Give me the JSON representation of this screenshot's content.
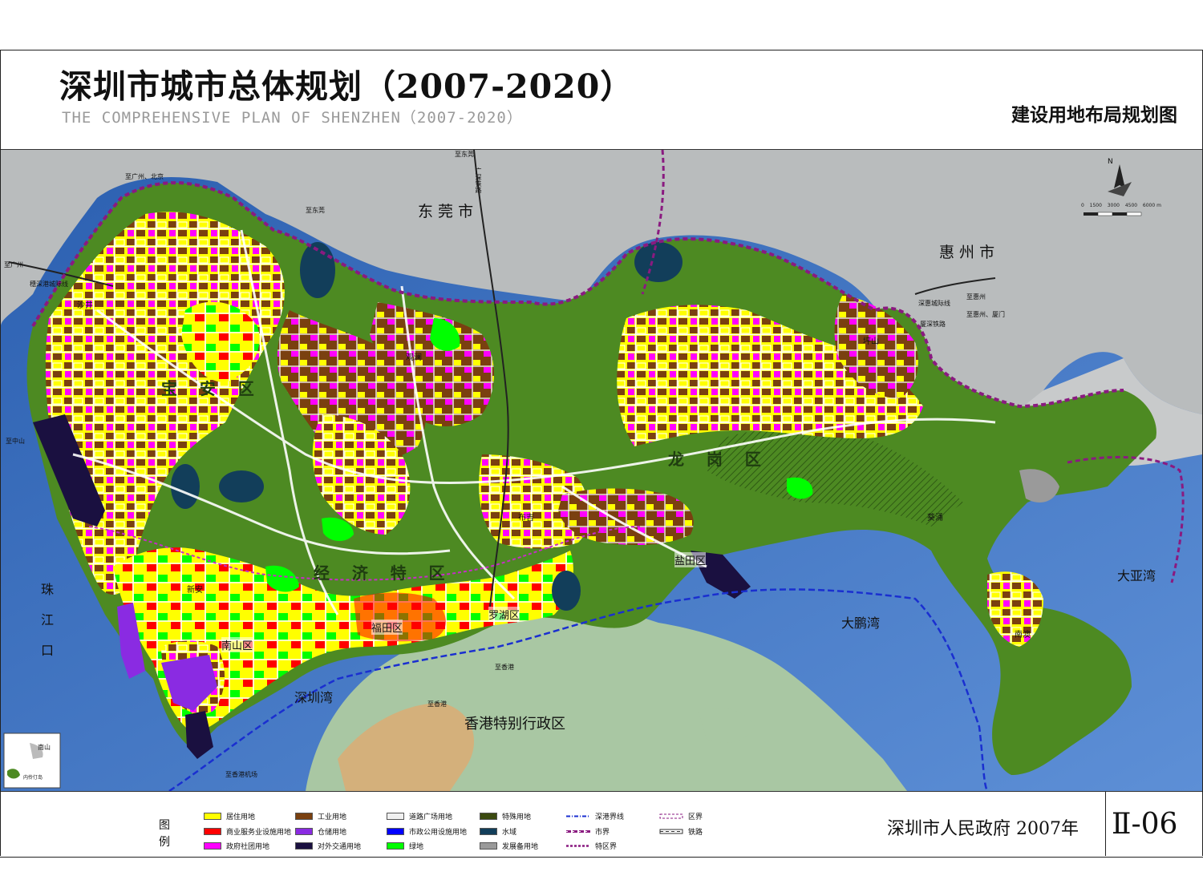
{
  "header": {
    "title": "深圳市城市总体规划（2007-2020）",
    "subtitle": "THE COMPREHENSIVE PLAN OF SHENZHEN（2007-2020）",
    "map_title": "建设用地布局规划图"
  },
  "map": {
    "regions": {
      "dongguan": "东 莞 市",
      "huizhou": "惠 州 市",
      "hongkong": "香港特别行政区",
      "baoan": "宝    安    区",
      "longgang": "龙    岗    区",
      "sez": "经    济    特    区",
      "nanshan": "南山区",
      "futian": "福田区",
      "luohu": "罗湖区",
      "yantian": "盐田区",
      "xin_an": "新安",
      "nanao": "南澳",
      "shajing": "沙井",
      "guanlan": "观澜",
      "buji": "布吉",
      "pingshan": "坪山",
      "kuichong": "葵涌"
    },
    "waters": {
      "pearl_river": "珠\n江\n口",
      "shenzhen_bay": "深圳湾",
      "dapeng_bay": "大鹏湾",
      "daya_bay": "大亚湾"
    },
    "routes": {
      "to_dongguan_top": "至东莞",
      "to_guangzhou_beijing": "至广州、北京",
      "to_dongguan": "至东莞",
      "to_guangzhou": "至广州",
      "guangshen_intercity": "穗深港城际线",
      "guangshen_rail": "广深铁路",
      "to_zhongshan": "至中山",
      "to_huizhou": "至惠州",
      "shenhui_intercity": "深惠城际线",
      "to_huizhou_xiamen": "至惠州、厦门",
      "xiamen_shenzhen_rail": "厦深铁路",
      "to_hk_1": "至香港",
      "to_hk_2": "至香港",
      "to_hk_airport": "至香港机场"
    },
    "inset": {
      "island": "南山",
      "islet": "内伶仃岛"
    },
    "scale_bar": {
      "north": "N",
      "ticks": [
        "0",
        "1500",
        "3000",
        "4500",
        "6000 m"
      ]
    },
    "colors": {
      "sea": "#3b6fbf",
      "sea_light": "#7fa6da",
      "land_outside": "#b9bcbd",
      "greenbelt": "#4d8a22",
      "hk_land": "#a9c7a3",
      "residential": "#ffff00",
      "industrial": "#7a4010",
      "road": "#eeeeee",
      "special": "#3b4a10",
      "commercial": "#ff0000",
      "warehouse": "#8a2be2",
      "utilities": "#0000ff",
      "water": "#123e5a",
      "government": "#ff00ff",
      "transport": "#1a1040",
      "green": "#00ff00",
      "reserve": "#9a9a9a"
    }
  },
  "legend": {
    "heading": "图\n例",
    "items": [
      {
        "label": "居住用地",
        "color": "#ffff00"
      },
      {
        "label": "商业服务业设施用地",
        "color": "#ff0000"
      },
      {
        "label": "政府社团用地",
        "color": "#ff00ff"
      },
      {
        "label": "工业用地",
        "color": "#7a4010"
      },
      {
        "label": "仓储用地",
        "color": "#8a2be2"
      },
      {
        "label": "对外交通用地",
        "color": "#1a1040"
      },
      {
        "label": "道路广场用地",
        "color": "#f0f0f0"
      },
      {
        "label": "市政公用设施用地",
        "color": "#0000ff"
      },
      {
        "label": "绿地",
        "color": "#00ff00"
      },
      {
        "label": "特殊用地",
        "color": "#3b4a10"
      },
      {
        "label": "水域",
        "color": "#123e5a"
      },
      {
        "label": "发展备用地",
        "color": "#9a9a9a"
      }
    ],
    "lines": [
      {
        "label": "深港界线",
        "color": "#1a2fd0"
      },
      {
        "label": "市界",
        "color": "#8a1a80"
      },
      {
        "label": "特区界",
        "color": "#8a1a80"
      },
      {
        "label": "区界",
        "color": "#8a1a80"
      },
      {
        "label": "铁路",
        "color": "#333333"
      }
    ]
  },
  "footer": {
    "government": "深圳市人民政府 2007年",
    "sheet_number": "Ⅱ-06"
  }
}
